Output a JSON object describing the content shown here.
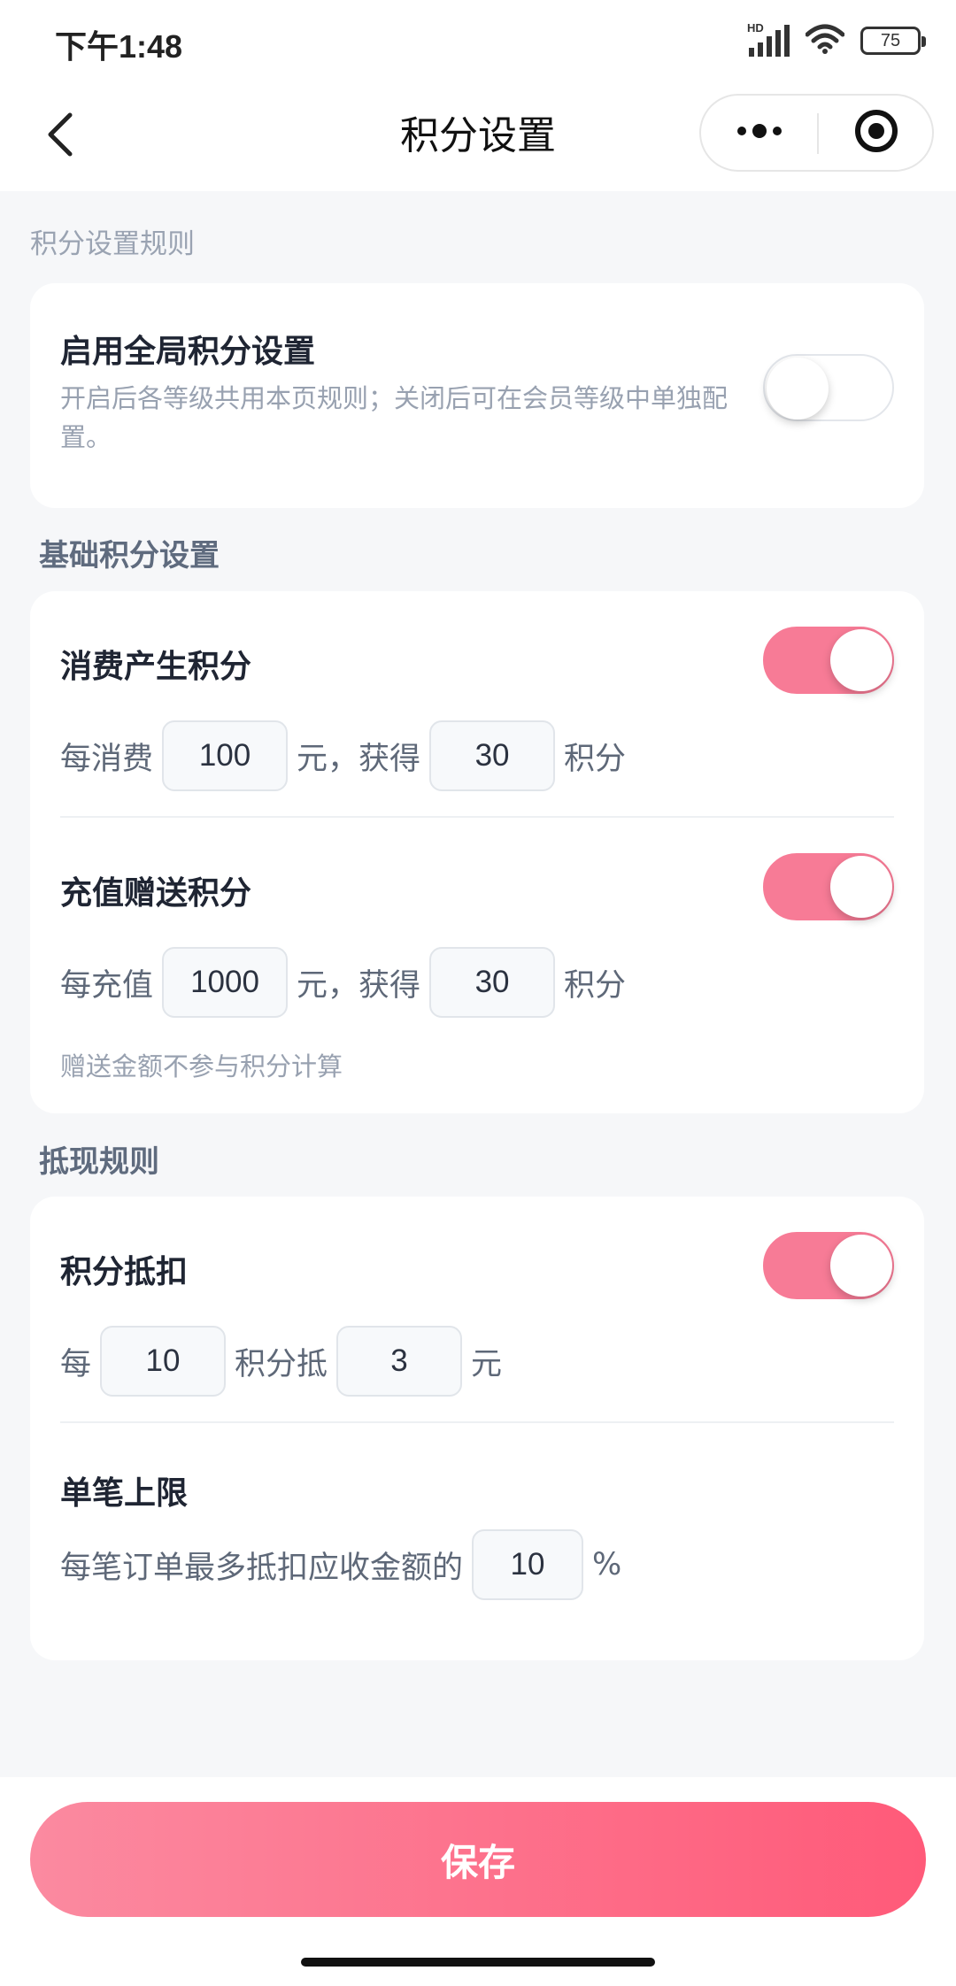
{
  "status_bar": {
    "time": "下午1:48",
    "battery": "75",
    "network_label": "HD"
  },
  "nav": {
    "title": "积分设置"
  },
  "hint": {
    "text": "积分设置规则"
  },
  "global": {
    "title": "启用全局积分设置",
    "desc": "开启后各等级共用本页规则；关闭后可在会员等级中单独配置。",
    "enabled": false
  },
  "basic": {
    "section_title": "基础积分设置",
    "consume": {
      "title": "消费产生积分",
      "enabled": true,
      "prefix": "每消费",
      "amount": "100",
      "middle": "元，获得",
      "points": "30",
      "suffix": "积分"
    },
    "recharge": {
      "title": "充值赠送积分",
      "enabled": true,
      "prefix": "每充值",
      "amount": "1000",
      "middle": "元，获得",
      "points": "30",
      "suffix": "积分",
      "note": "赠送金额不参与积分计算"
    }
  },
  "cashout": {
    "section_title": "抵现规则",
    "deduct": {
      "title": "积分抵扣",
      "enabled": true,
      "prefix": "每",
      "points": "10",
      "middle": "积分抵",
      "amount": "3",
      "suffix": "元"
    },
    "limit": {
      "title": "单笔上限",
      "prefix": "每笔订单最多抵扣应收金额的",
      "value": "10",
      "suffix": "%"
    }
  },
  "footer": {
    "save_label": "保存"
  },
  "colors": {
    "accent": "#f77b96",
    "save_gradient_start": "#fb8aa0",
    "save_gradient_end": "#ff5a79"
  }
}
